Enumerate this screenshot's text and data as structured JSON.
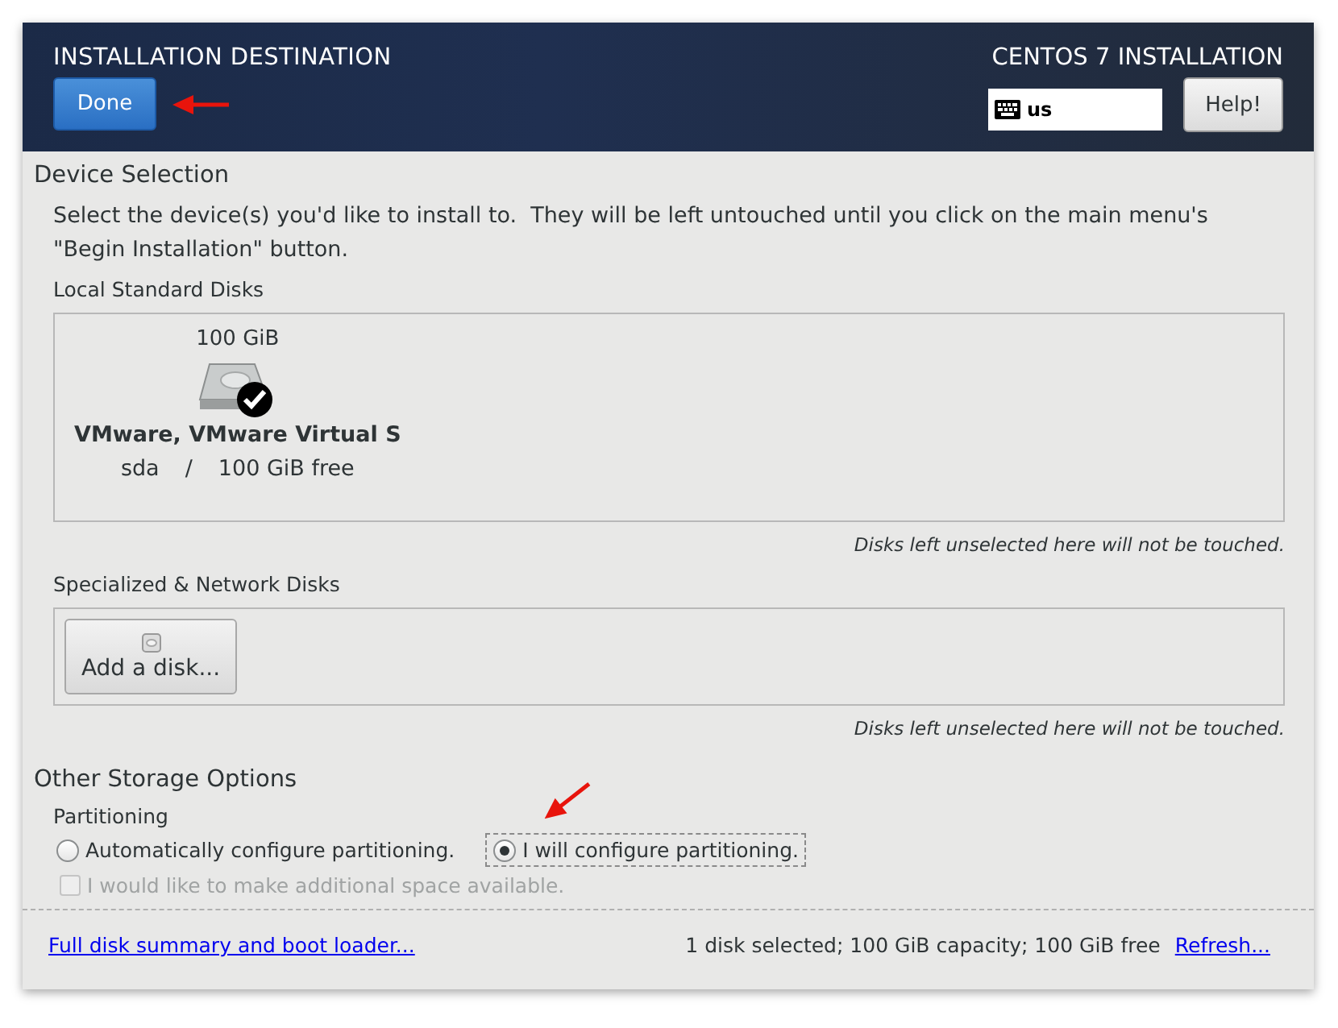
{
  "header": {
    "title": "INSTALLATION DESTINATION",
    "done_button": "Done",
    "product": "CENTOS 7 INSTALLATION",
    "keyboard_layout": "us",
    "help_button": "Help!"
  },
  "device_selection": {
    "heading": "Device Selection",
    "description": "Select the device(s) you'd like to install to.  They will be left untouched until you click on the main menu's \"Begin Installation\" button.",
    "local_disks": {
      "heading": "Local Standard Disks",
      "disks": [
        {
          "size": "100 GiB",
          "name": "VMware, VMware Virtual S",
          "device": "sda",
          "separator": "/",
          "free": "100 GiB free",
          "selected": true
        }
      ],
      "note": "Disks left unselected here will not be touched."
    },
    "specialized_disks": {
      "heading": "Specialized & Network Disks",
      "add_button": "Add a disk...",
      "note": "Disks left unselected here will not be touched."
    }
  },
  "other_storage": {
    "heading": "Other Storage Options",
    "partitioning": {
      "heading": "Partitioning",
      "options": [
        {
          "label": "Automatically configure partitioning.",
          "selected": false
        },
        {
          "label": "I will configure partitioning.",
          "selected": true
        }
      ]
    },
    "reclaim": {
      "label": "I would like to make additional space available.",
      "checked": false,
      "disabled": true
    }
  },
  "footer": {
    "summary_link": "Full disk summary and boot loader...",
    "status": "1 disk selected; 100 GiB capacity; 100 GiB free",
    "refresh_link": "Refresh..."
  }
}
